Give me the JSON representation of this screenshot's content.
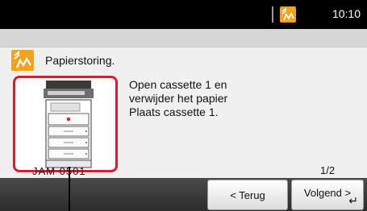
{
  "status_bar": {
    "time": "10:10",
    "status_icon": "error-warning-icon",
    "accent": "#f2a31b"
  },
  "message": {
    "icon": "error-warning-icon",
    "title": "Papierstoring.",
    "body": "Open cassette 1 en\nverwijder het papier\nPlaats cassette 1.",
    "location_code": "JAM 0501",
    "page": "1/2",
    "highlight_color": "#e0192c"
  },
  "buttons": {
    "back_label": "< Terug",
    "next_label": "Volgend >",
    "next_icon": "enter-return-icon"
  }
}
